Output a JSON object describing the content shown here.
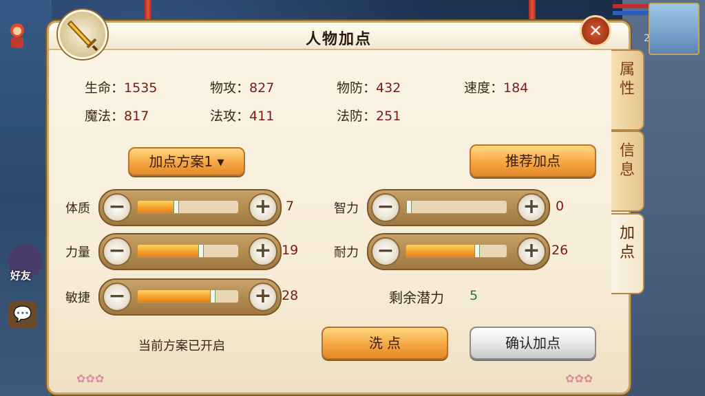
{
  "window": {
    "title": "人物加点",
    "close_label": "✕"
  },
  "hud": {
    "friend_label": "好友",
    "avatar_level": "2"
  },
  "stats": [
    {
      "label": "生命：",
      "value": "1535"
    },
    {
      "label": "物攻：",
      "value": "827"
    },
    {
      "label": "物防：",
      "value": "432"
    },
    {
      "label": "速度：",
      "value": "184"
    },
    {
      "label": "魔法：",
      "value": "817"
    },
    {
      "label": "法攻：",
      "value": "411"
    },
    {
      "label": "法防：",
      "value": "251"
    }
  ],
  "buttons": {
    "scheme_select": "加点方案1 ▾",
    "recommend": "推荐加点",
    "reset": "洗  点",
    "confirm": "确认加点"
  },
  "attributes": [
    {
      "label": "体质",
      "value": "7",
      "fill_fraction": 0.38
    },
    {
      "label": "力量",
      "value": "19",
      "fill_fraction": 0.62
    },
    {
      "label": "敏捷",
      "value": "28",
      "fill_fraction": 0.74
    },
    {
      "label": "智力",
      "value": "0",
      "fill_fraction": 0.0
    },
    {
      "label": "耐力",
      "value": "26",
      "fill_fraction": 0.7
    }
  ],
  "potential": {
    "label": "剩余潜力",
    "value": "5"
  },
  "scheme_status": "当前方案已开启",
  "tabs": [
    {
      "label": "属性",
      "active": false
    },
    {
      "label": "信息",
      "active": false
    },
    {
      "label": "加点",
      "active": true
    }
  ],
  "icons": {
    "slider_minus": "−",
    "slider_plus": "+",
    "chat": "💬"
  },
  "colors": {
    "panel_bg": "#fbf5e8",
    "accent_orange": "#f6a544",
    "value_red": "#7a1a14",
    "potential_green": "#2a7a2a"
  }
}
